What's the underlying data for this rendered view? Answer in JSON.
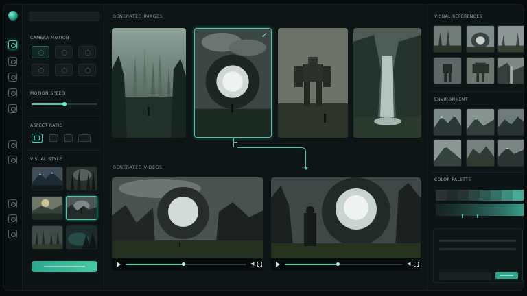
{
  "left_panel": {
    "camera_motion_label": "CAMERA MOTION",
    "motion_speed_label": "MOTION SPEED",
    "motion_speed_value": 0.5,
    "aspect_ratio_label": "ASPECT RATIO",
    "visual_style_label": "VISUAL STYLE"
  },
  "center": {
    "generated_images_label": "GENERATED IMAGES",
    "generated_videos_label": "GENERATED VIDEOS",
    "selected_image_index": 1,
    "videos": [
      {
        "progress": 0.48
      },
      {
        "progress": 0.45
      }
    ]
  },
  "right_panel": {
    "visual_references_label": "VISUAL REFERENCES",
    "environment_label": "ENVIRONMENT",
    "color_palette_label": "COLOR PALETTE",
    "palette_colors": [
      "#2a3234",
      "#1f2a2a",
      "#243534",
      "#2b4543",
      "#2f5954",
      "#347066",
      "#3e8e7e",
      "#4aa996"
    ]
  },
  "colors": {
    "accent": "#3fcfae",
    "background": "#0b1213"
  },
  "icons": {
    "rail": [
      "home-icon",
      "edit-icon",
      "layers-icon",
      "settings-icon",
      "cube-icon",
      "image-icon",
      "shield-icon",
      "help-icon",
      "list-icon",
      "box-icon"
    ]
  }
}
